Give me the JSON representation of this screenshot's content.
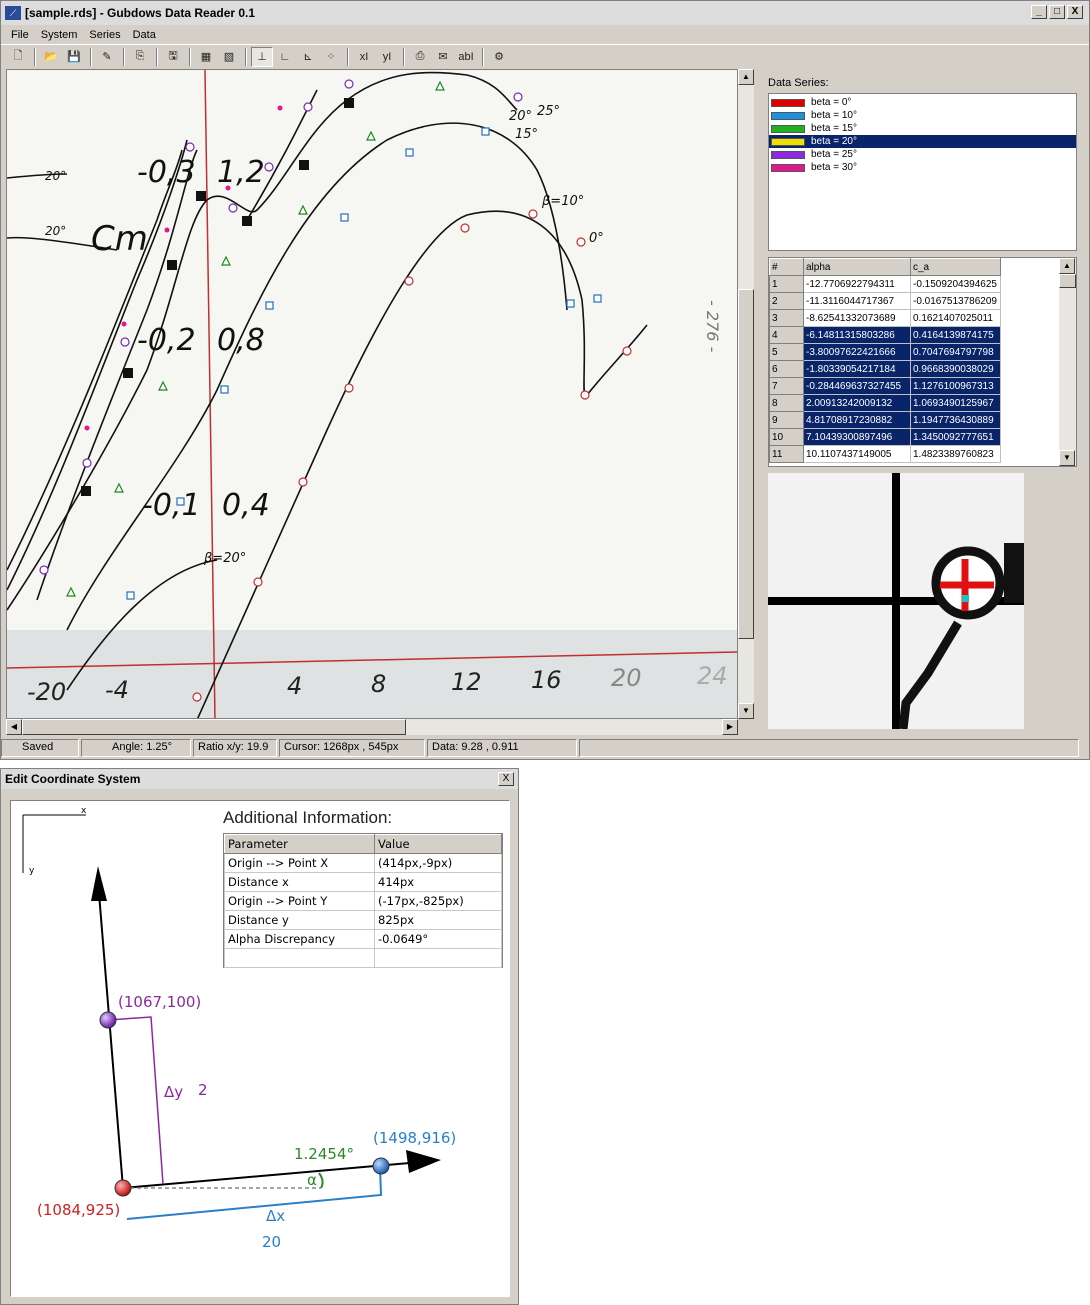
{
  "window": {
    "title": "[sample.rds] - Gubdows Data Reader 0.1",
    "app_icon": "chart-app-icon",
    "controls": [
      "_",
      "□",
      "X"
    ]
  },
  "menu": [
    "File",
    "System",
    "Series",
    "Data"
  ],
  "toolbar": [
    {
      "name": "new-file-button",
      "icon": "🗋"
    },
    {
      "sep": true
    },
    {
      "name": "open-file-button",
      "icon": "📂"
    },
    {
      "name": "save-file-button",
      "icon": "💾"
    },
    {
      "sep": true
    },
    {
      "name": "calibrate-button",
      "icon": "✎"
    },
    {
      "sep": true
    },
    {
      "name": "copy-button",
      "icon": "⎘"
    },
    {
      "sep": true
    },
    {
      "name": "save-image-button",
      "icon": "🖫"
    },
    {
      "sep": true
    },
    {
      "name": "image-view-button",
      "icon": "▦"
    },
    {
      "name": "image-compare-button",
      "icon": "▧"
    },
    {
      "sep": true
    },
    {
      "name": "axis-origin-button",
      "icon": "⊥",
      "active": true
    },
    {
      "name": "axis-x-button",
      "icon": "∟"
    },
    {
      "name": "axis-y-button",
      "icon": "⊾"
    },
    {
      "name": "scatter-points-button",
      "icon": "⁘"
    },
    {
      "sep": true
    },
    {
      "name": "x-value-button",
      "icon": "xI"
    },
    {
      "name": "y-value-button",
      "icon": "yI"
    },
    {
      "sep": true
    },
    {
      "name": "export-button",
      "icon": "⎙"
    },
    {
      "name": "notes-button",
      "icon": "✉"
    },
    {
      "name": "text-button",
      "icon": "abI"
    },
    {
      "sep": true
    },
    {
      "name": "settings-button",
      "icon": "⚙"
    }
  ],
  "side": {
    "series_label": "Data Series:",
    "series": [
      {
        "label": "beta = 0°",
        "color": "#e00000",
        "selected": false
      },
      {
        "label": "beta = 10°",
        "color": "#1e90e0",
        "selected": false
      },
      {
        "label": "beta = 15°",
        "color": "#20b020",
        "selected": false
      },
      {
        "label": "beta = 20°",
        "color": "#f0e000",
        "selected": true
      },
      {
        "label": "beta = 25°",
        "color": "#8a2be2",
        "selected": false
      },
      {
        "label": "beta = 30°",
        "color": "#e01890",
        "selected": false
      }
    ],
    "table": {
      "headers": [
        "#",
        "alpha",
        "c_a"
      ],
      "rows": [
        [
          "1",
          "-12.7706922794311",
          "-0.1509204394625",
          false
        ],
        [
          "2",
          "-11.3116044717367",
          "-0.0167513786209",
          false
        ],
        [
          "3",
          "-8.62541332073689",
          "0.1621407025011",
          false
        ],
        [
          "4",
          "-6.14811315803286",
          "0.4164139874175",
          true
        ],
        [
          "5",
          "-3.80097622421666",
          "0.7047694797798",
          true
        ],
        [
          "6",
          "-1.80339054217184",
          "0.9668390038029",
          true
        ],
        [
          "7",
          "-0.284469637327455",
          "1.1276100967313",
          true
        ],
        [
          "8",
          "2.00913242009132",
          "1.0693490125967",
          true
        ],
        [
          "9",
          "4.81708917230882",
          "1.1947736430889",
          true
        ],
        [
          "10",
          "7.10439300897496",
          "1.3450092777651",
          true
        ],
        [
          "11",
          "10.1107437149005",
          "1.4823389760823",
          false
        ]
      ]
    }
  },
  "status": {
    "state": "Saved",
    "angle": "Angle: 1.25°",
    "ratio": "Ratio x/y: 19.9",
    "cursor": "Cursor: 1268px , 545px",
    "data": "Data: 9.28 , 0.911"
  },
  "canvas": {
    "axis_labels_x": [
      "-20",
      "-4",
      "4",
      "8",
      "12",
      "16",
      "20",
      "24"
    ],
    "annotations": [
      "-0,3",
      "1,2",
      "-0,2",
      "0,8",
      "-0,1",
      "0,4",
      "20°",
      "20°",
      "Cm",
      "25°",
      "15°",
      "20°",
      "β=10°",
      "0°",
      "β=20°",
      "- 276 -"
    ]
  },
  "dialog": {
    "title": "Edit Coordinate System",
    "close": "X",
    "info_heading": "Additional Information:",
    "info_headers": [
      "Parameter",
      "Value"
    ],
    "info_rows": [
      [
        "Origin --> Point X",
        "(414px,-9px)"
      ],
      [
        "Distance x",
        "414px"
      ],
      [
        "Origin --> Point Y",
        "(-17px,-825px)"
      ],
      [
        "Distance y",
        "825px"
      ],
      [
        "Alpha Discrepancy",
        "-0.0649°"
      ]
    ],
    "diagram": {
      "axis_x_label": "x",
      "axis_y_label": "y",
      "point_y": "(1067,100)",
      "point_origin": "(1084,925)",
      "point_x": "(1498,916)",
      "delta_y_label": "Δy",
      "delta_y_value": "2",
      "delta_x_label": "Δx",
      "delta_x_value": "20",
      "alpha_label": "α",
      "alpha_value": "1.2454°",
      "colors": {
        "y": "#8a2a9a",
        "x": "#2a80c8",
        "origin": "#d02020",
        "alpha": "#2a8a2a"
      }
    }
  }
}
